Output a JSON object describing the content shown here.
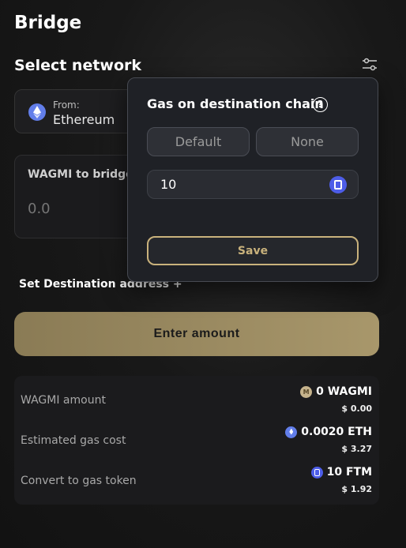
{
  "page": {
    "title": "Bridge"
  },
  "network": {
    "section_title": "Select network",
    "from_label": "From:",
    "from_network": "Ethereum"
  },
  "bridge": {
    "label": "WAGMI to bridge",
    "amount_placeholder": "0.0"
  },
  "destination": {
    "link_label": "Set Destination address +"
  },
  "actions": {
    "enter_amount": "Enter amount"
  },
  "summary": {
    "rows": [
      {
        "label": "WAGMI amount",
        "value": "0 WAGMI",
        "usd": "$ 0.00",
        "icon": "wagmi-token-icon"
      },
      {
        "label": "Estimated gas cost",
        "value": "0.0020 ETH",
        "usd": "$ 3.27",
        "icon": "eth-token-icon"
      },
      {
        "label": "Convert to gas token",
        "value": "10 FTM",
        "usd": "$ 1.92",
        "icon": "ftm-token-icon"
      }
    ]
  },
  "gas_popover": {
    "title": "Gas on destination chain",
    "help": "?",
    "option_default": "Default",
    "option_none": "None",
    "amount_value": "10",
    "save_label": "Save"
  },
  "colors": {
    "accent_gold": "#c9b27c",
    "button_gold": "#a8976b",
    "eth_blue": "#627eea",
    "ftm_blue": "#4d5de8"
  }
}
